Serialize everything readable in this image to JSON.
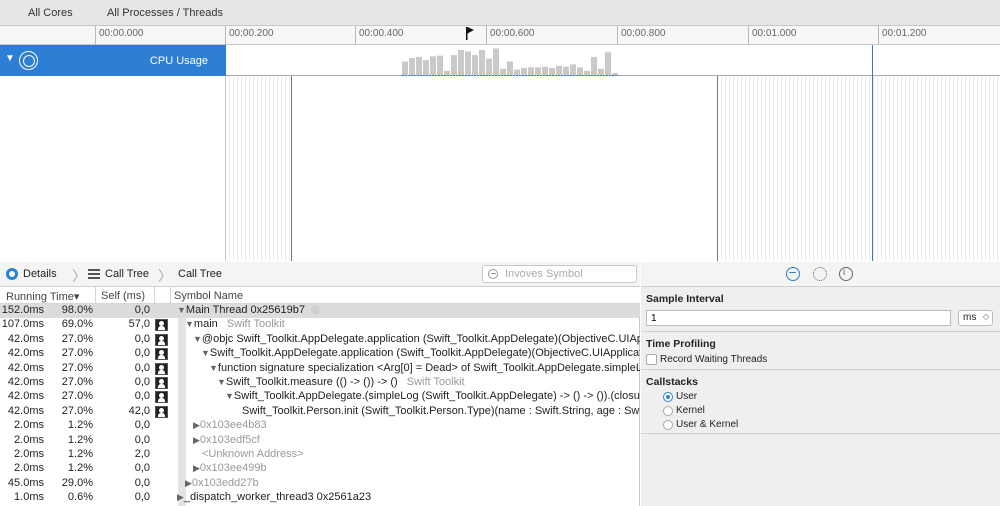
{
  "scope_bar": {
    "cores": "All Cores",
    "processes": "All Processes / Threads"
  },
  "ruler": {
    "ticks": [
      "00:00.000",
      "00:00.200",
      "00:00.400",
      "00:00.600",
      "00:00.800",
      "00:01.000",
      "00:01.200"
    ]
  },
  "track": {
    "label": "CPU Usage"
  },
  "detail": {
    "jump_bar": {
      "details": "Details",
      "call_tree_1": "Call Tree",
      "call_tree_2": "Call Tree"
    },
    "search_placeholder": "Invoves Symbol",
    "columns": {
      "running_time": "Running Time▾",
      "self": "Self (ms)",
      "symbol": "Symbol Name"
    },
    "rows": [
      {
        "time": "152.0ms",
        "pct": "98.0%",
        "self": "0,0",
        "person": false,
        "indent": 0,
        "tri": "▼",
        "symbol": "Main Thread  0x25619b7",
        "lib": "",
        "grey": false,
        "link": true
      },
      {
        "time": "107.0ms",
        "pct": "69.0%",
        "self": "57,0",
        "person": true,
        "indent": 1,
        "tri": "▼",
        "symbol": "main",
        "lib": "Swift Toolkit",
        "grey": false,
        "link": false
      },
      {
        "time": "42.0ms",
        "pct": "27.0%",
        "self": "0,0",
        "person": true,
        "indent": 2,
        "tri": "▼",
        "symbol": "@objc Swift_Toolkit.AppDelegate.application (Swift_Toolkit.AppDelegate)(ObjectiveC.UIAppl",
        "lib": "",
        "grey": false,
        "link": false
      },
      {
        "time": "42.0ms",
        "pct": "27.0%",
        "self": "0,0",
        "person": true,
        "indent": 3,
        "tri": "▼",
        "symbol": "Swift_Toolkit.AppDelegate.application (Swift_Toolkit.AppDelegate)(ObjectiveC.UIApplicati",
        "lib": "",
        "grey": false,
        "link": false
      },
      {
        "time": "42.0ms",
        "pct": "27.0%",
        "self": "0,0",
        "person": true,
        "indent": 4,
        "tri": "▼",
        "symbol": "function signature specialization <Arg[0] = Dead> of Swift_Toolkit.AppDelegate.simpleLo",
        "lib": "",
        "grey": false,
        "link": false
      },
      {
        "time": "42.0ms",
        "pct": "27.0%",
        "self": "0,0",
        "person": true,
        "indent": 5,
        "tri": "▼",
        "symbol": "Swift_Toolkit.measure (() -> ()) -> ()",
        "lib": "Swift Toolkit",
        "grey": false,
        "link": false
      },
      {
        "time": "42.0ms",
        "pct": "27.0%",
        "self": "0,0",
        "person": true,
        "indent": 6,
        "tri": "▼",
        "symbol": "Swift_Toolkit.AppDelegate.(simpleLog (Swift_Toolkit.AppDelegate) -> () -> ()).(closure",
        "lib": "",
        "grey": false,
        "link": false
      },
      {
        "time": "42.0ms",
        "pct": "27.0%",
        "self": "42,0",
        "person": true,
        "indent": 7,
        "tri": "",
        "symbol": "Swift_Toolkit.Person.init (Swift_Toolkit.Person.Type)(name : Swift.String, age : Swift",
        "lib": "",
        "grey": false,
        "link": false
      },
      {
        "time": "2.0ms",
        "pct": "1.2%",
        "self": "0,0",
        "person": false,
        "indent": 2,
        "tri": "▶",
        "symbol": "0x103ee4b83",
        "lib": "",
        "grey": true,
        "link": false
      },
      {
        "time": "2.0ms",
        "pct": "1.2%",
        "self": "0,0",
        "person": false,
        "indent": 2,
        "tri": "▶",
        "symbol": "0x103edf5cf",
        "lib": "",
        "grey": true,
        "link": false
      },
      {
        "time": "2.0ms",
        "pct": "1.2%",
        "self": "2,0",
        "person": false,
        "indent": 2,
        "tri": "",
        "symbol": "<Unknown Address>",
        "lib": "",
        "grey": true,
        "link": false
      },
      {
        "time": "2.0ms",
        "pct": "1.2%",
        "self": "0,0",
        "person": false,
        "indent": 2,
        "tri": "▶",
        "symbol": "0x103ee499b",
        "lib": "",
        "grey": true,
        "link": false
      },
      {
        "time": "45.0ms",
        "pct": "29.0%",
        "self": "0,0",
        "person": false,
        "indent": 1,
        "tri": "▶",
        "symbol": "0x103edd27b",
        "lib": "",
        "grey": true,
        "link": false
      },
      {
        "time": "1.0ms",
        "pct": "0.6%",
        "self": "0,0",
        "person": false,
        "indent": 0,
        "tri": "▶",
        "symbol": "_dispatch_worker_thread3  0x2561a23",
        "lib": "",
        "grey": false,
        "link": false
      }
    ]
  },
  "inspector": {
    "sample_interval": {
      "title": "Sample Interval",
      "value": "1",
      "unit": "ms"
    },
    "time_profiling": {
      "title": "Time Profiling",
      "record_waiting": "Record Waiting Threads"
    },
    "callstacks": {
      "title": "Callstacks",
      "options": [
        "User",
        "Kernel",
        "User & Kernel"
      ],
      "selected": 0
    }
  },
  "colors": {
    "accent": "#2d7fd6",
    "selection": "#dcdcdc"
  },
  "icons": [
    "flag-icon",
    "cpu-gauge-icon",
    "disclosure-triangle-icon",
    "details-icon",
    "call-tree-icon",
    "search-icon",
    "person-icon",
    "link-icon",
    "waveform-icon",
    "gear-icon",
    "info-icon"
  ],
  "cpu_usage": [
    0.5,
    0.62,
    0.66,
    0.55,
    0.68,
    0.7,
    0.18,
    0.72,
    0.9,
    0.85,
    0.72,
    0.9,
    0.6,
    0.95,
    0.25,
    0.5,
    0.22,
    0.28,
    0.3,
    0.3,
    0.32,
    0.28,
    0.35,
    0.32,
    0.4,
    0.3,
    0.18,
    0.66,
    0.25,
    0.82,
    0.1
  ]
}
